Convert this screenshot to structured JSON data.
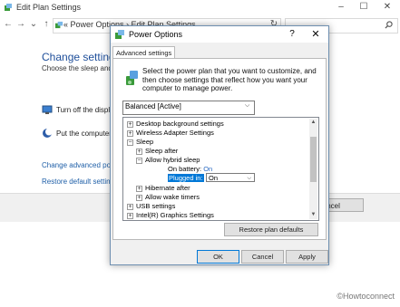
{
  "background": {
    "window_title": "Edit Plan Settings",
    "window_controls": {
      "minimize": "–",
      "maximize": "☐",
      "close": "✕"
    },
    "nav": {
      "back": "←",
      "forward": "→",
      "recent": "⌄",
      "up": "↑"
    },
    "address": "«  Power Options  ›  Edit Plan Settings",
    "address_refresh": "↻",
    "search_placeholder": "",
    "heading": "Change settings fo",
    "subheading": "Choose the sleep and di",
    "rows": [
      {
        "label": "Turn off the display"
      },
      {
        "label": "Put the computer to"
      }
    ],
    "links": {
      "advanced": "Change advanced powe",
      "restore": "Restore default settings"
    },
    "cancel_label": "Cancel",
    "watermark": "©Howtoconnect"
  },
  "dialog": {
    "title": "Power Options",
    "help": "?",
    "close": "✕",
    "tab": "Advanced settings",
    "description": "Select the power plan that you want to customize, and then choose settings that reflect how you want your computer to manage power.",
    "plan": "Balanced [Active]",
    "tree": [
      {
        "label": "Desktop background settings",
        "expander": "⊞"
      },
      {
        "label": "Wireless Adapter Settings",
        "expander": "⊞"
      },
      {
        "label": "Sleep",
        "expander": "⊟"
      },
      {
        "label": "Sleep after",
        "expander": "⊞"
      },
      {
        "label": "Allow hybrid sleep",
        "expander": "⊟"
      },
      {
        "label": "On battery:",
        "value": "On"
      },
      {
        "label": "Plugged in:",
        "value": "On"
      },
      {
        "label": "Hibernate after",
        "expander": "⊞"
      },
      {
        "label": "Allow wake timers",
        "expander": "⊞"
      },
      {
        "label": "USB settings",
        "expander": "⊞"
      },
      {
        "label": "Intel(R) Graphics Settings",
        "expander": "⊞"
      }
    ],
    "restore_label": "Restore plan defaults",
    "buttons": {
      "ok": "OK",
      "cancel": "Cancel",
      "apply": "Apply"
    }
  },
  "colors": {
    "heading": "#1e4e9a",
    "link": "#2060a8",
    "selection": "#0078d7",
    "on_battery_value": "#2a6ac2"
  }
}
